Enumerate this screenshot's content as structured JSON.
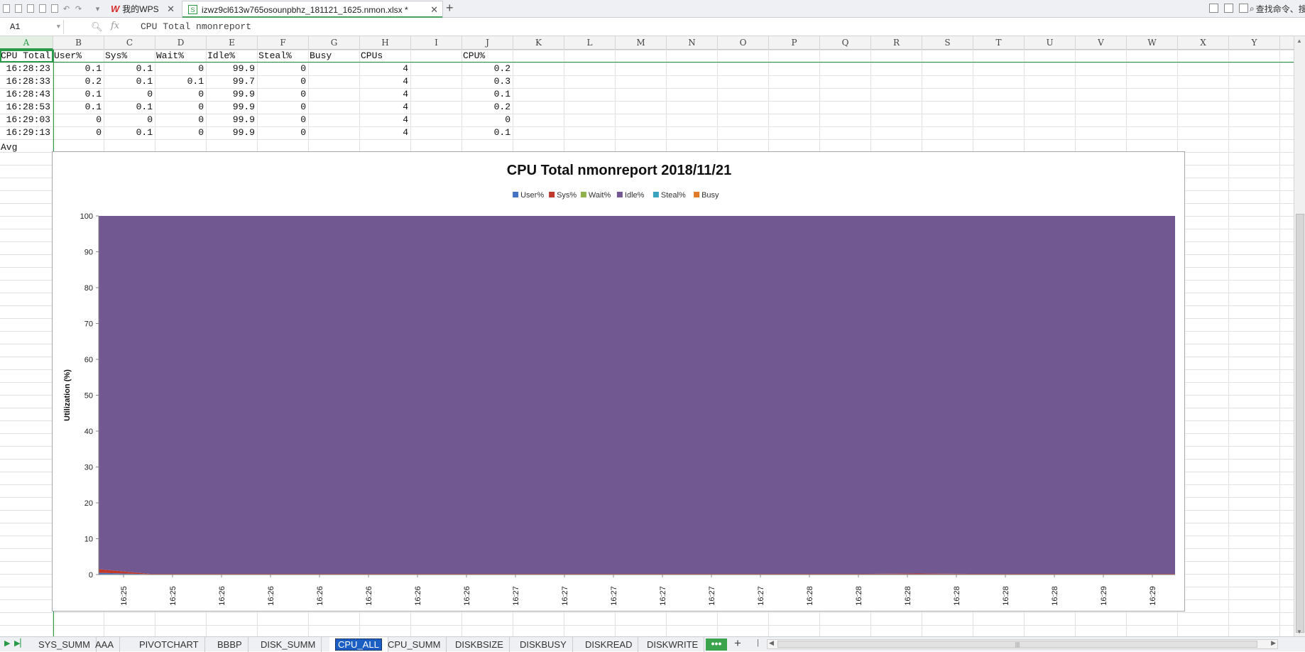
{
  "window": {
    "wps_tab": "我的WPS",
    "file_tab": "izwz9cl613w765osounpbhz_181121_1625.nmon.xlsx *",
    "search_cmd": "查找命令、搜"
  },
  "formula_bar": {
    "cell_ref": "A1",
    "fx": "fx",
    "content": "CPU Total nmonreport"
  },
  "columns": [
    "A",
    "B",
    "C",
    "D",
    "E",
    "F",
    "G",
    "H",
    "I",
    "J",
    "K",
    "L",
    "M",
    "N",
    "O",
    "P",
    "Q",
    "R",
    "S",
    "T",
    "U",
    "V",
    "W",
    "X",
    "Y"
  ],
  "sheet": {
    "header_row": [
      "CPU Total",
      "User%",
      "Sys%",
      "Wait%",
      "Idle%",
      "Steal%",
      "Busy",
      "CPUs",
      "",
      "CPU%"
    ],
    "rows": [
      [
        "16:28:23",
        "0.1",
        "0.1",
        "0",
        "99.9",
        "0",
        "",
        "4",
        "",
        "0.2"
      ],
      [
        "16:28:33",
        "0.2",
        "0.1",
        "0.1",
        "99.7",
        "0",
        "",
        "4",
        "",
        "0.3"
      ],
      [
        "16:28:43",
        "0.1",
        "0",
        "0",
        "99.9",
        "0",
        "",
        "4",
        "",
        "0.1"
      ],
      [
        "16:28:53",
        "0.1",
        "0.1",
        "0",
        "99.9",
        "0",
        "",
        "4",
        "",
        "0.2"
      ],
      [
        "16:29:03",
        "0",
        "0",
        "0",
        "99.9",
        "0",
        "",
        "4",
        "",
        "0"
      ],
      [
        "16:29:13",
        "0",
        "0.1",
        "0",
        "99.9",
        "0",
        "",
        "4",
        "",
        "0.1"
      ]
    ],
    "avg_label": "Avg"
  },
  "chart_data": {
    "type": "area",
    "stacked": true,
    "title": "CPU Total nmonreport  2018/11/21",
    "xlabel": "",
    "ylabel": "Utilization (%)",
    "ylim": [
      0,
      100
    ],
    "yticks": [
      0,
      10,
      20,
      30,
      40,
      50,
      60,
      70,
      80,
      90,
      100
    ],
    "legend_position": "top-center",
    "categories": [
      "16:25",
      "16:25",
      "16:26",
      "16:26",
      "16:26",
      "16:26",
      "16:26",
      "16:26",
      "16:27",
      "16:27",
      "16:27",
      "16:27",
      "16:27",
      "16:27",
      "16:28",
      "16:28",
      "16:28",
      "16:28",
      "16:28",
      "16:28",
      "16:29",
      "16:29"
    ],
    "series": [
      {
        "name": "User%",
        "color": "#4472c4",
        "values": [
          0.5,
          0.1,
          0.1,
          0.1,
          0.1,
          0.1,
          0.1,
          0.1,
          0.1,
          0.1,
          0.1,
          0.1,
          0.1,
          0.1,
          0.1,
          0.1,
          0.1,
          0.1,
          0.1,
          0.1,
          0.1,
          0.1
        ]
      },
      {
        "name": "Sys%",
        "color": "#c0392b",
        "values": [
          1.0,
          0.1,
          0.1,
          0.1,
          0.1,
          0.1,
          0.1,
          0.1,
          0.1,
          0.1,
          0.1,
          0.1,
          0.1,
          0.1,
          0.1,
          0.1,
          0.2,
          0.1,
          0.1,
          0.1,
          0.1,
          0.1
        ]
      },
      {
        "name": "Wait%",
        "color": "#8fb04a",
        "values": [
          0,
          0,
          0,
          0,
          0,
          0,
          0,
          0,
          0,
          0,
          0,
          0,
          0,
          0,
          0,
          0,
          0,
          0,
          0,
          0,
          0,
          0
        ]
      },
      {
        "name": "Idle%",
        "color": "#725890",
        "values": [
          98.5,
          99.8,
          99.8,
          99.8,
          99.8,
          99.8,
          99.8,
          99.8,
          99.8,
          99.8,
          99.8,
          99.8,
          99.8,
          99.8,
          99.8,
          99.8,
          99.7,
          99.8,
          99.8,
          99.8,
          99.8,
          99.8
        ]
      },
      {
        "name": "Steal%",
        "color": "#3ba3c2",
        "values": [
          0,
          0,
          0,
          0,
          0,
          0,
          0,
          0,
          0,
          0,
          0,
          0,
          0,
          0,
          0,
          0,
          0,
          0,
          0,
          0,
          0,
          0
        ]
      },
      {
        "name": "Busy",
        "color": "#e07b2a",
        "values": [
          0,
          0,
          0,
          0,
          0,
          0,
          0,
          0,
          0,
          0,
          0,
          0,
          0,
          0,
          0,
          0,
          0,
          0,
          0,
          0,
          0,
          0
        ]
      }
    ]
  },
  "sheet_tabs": [
    "SYS_SUMM",
    "AAA",
    "PIVOTCHART",
    "BBBP",
    "DISK_SUMM",
    "CPU_ALL",
    "CPU_SUMM",
    "DISKBSIZE",
    "DISKBUSY",
    "DISKREAD",
    "DISKWRITE"
  ],
  "active_sheet": "CPU_ALL",
  "more_label": "•••",
  "add_label": "+",
  "colors": {
    "accent": "#2a9a49",
    "active_sheet_bg": "#1b5fc2"
  }
}
